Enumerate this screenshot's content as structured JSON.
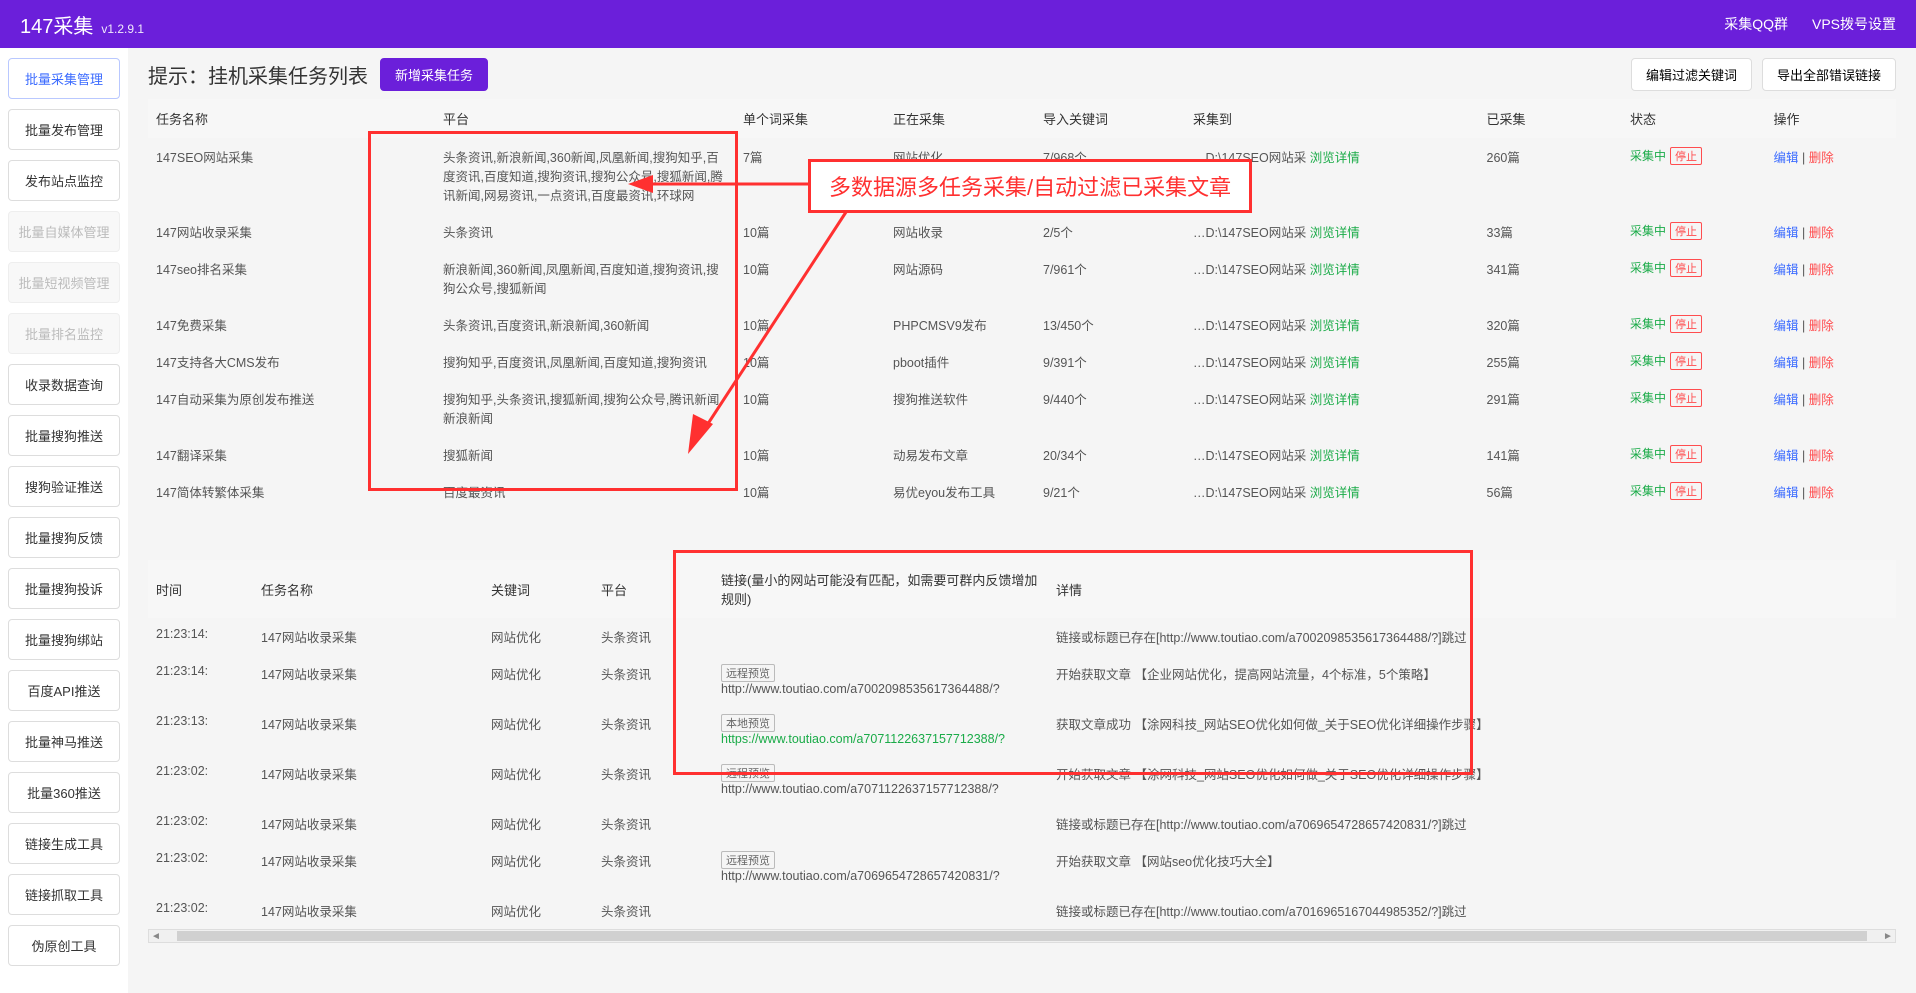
{
  "header": {
    "title": "147采集",
    "version": "v1.2.9.1",
    "links": {
      "qq": "采集QQ群",
      "vps": "VPS拨号设置"
    }
  },
  "sidebar": {
    "items": [
      {
        "label": "批量采集管理",
        "state": "active"
      },
      {
        "label": "批量发布管理",
        "state": ""
      },
      {
        "label": "发布站点监控",
        "state": ""
      },
      {
        "label": "批量自媒体管理",
        "state": "disabled"
      },
      {
        "label": "批量短视频管理",
        "state": "disabled"
      },
      {
        "label": "批量排名监控",
        "state": "disabled"
      },
      {
        "label": "收录数据查询",
        "state": ""
      },
      {
        "label": "批量搜狗推送",
        "state": ""
      },
      {
        "label": "搜狗验证推送",
        "state": ""
      },
      {
        "label": "批量搜狗反馈",
        "state": ""
      },
      {
        "label": "批量搜狗投诉",
        "state": ""
      },
      {
        "label": "批量搜狗绑站",
        "state": ""
      },
      {
        "label": "百度API推送",
        "state": ""
      },
      {
        "label": "批量神马推送",
        "state": ""
      },
      {
        "label": "批量360推送",
        "state": ""
      },
      {
        "label": "链接生成工具",
        "state": ""
      },
      {
        "label": "链接抓取工具",
        "state": ""
      },
      {
        "label": "伪原创工具",
        "state": ""
      }
    ]
  },
  "toolbar": {
    "title": "提示：挂机采集任务列表",
    "new_task": "新增采集任务",
    "edit_filter": "编辑过滤关键词",
    "export_errors": "导出全部错误链接"
  },
  "tasks": {
    "cols": {
      "name": "任务名称",
      "platform": "平台",
      "single": "单个词采集",
      "collecting": "正在采集",
      "imported": "导入关键词",
      "dest": "采集到",
      "collected": "已采集",
      "status": "状态",
      "action": "操作"
    },
    "status_running": "采集中",
    "status_stop": "停止",
    "browse": "浏览详情",
    "edit": "编辑",
    "delete": "删除",
    "rows": [
      {
        "name": "147SEO网站采集",
        "platform": "头条资讯,新浪新闻,360新闻,凤凰新闻,搜狗知乎,百度资讯,百度知道,搜狗资讯,搜狗公众号,搜狐新闻,腾讯新闻,网易资讯,一点资讯,百度最资讯,环球网",
        "single": "7篇",
        "collecting": "网站优化",
        "imported": "7/968个",
        "dest": "…D:\\147SEO网站采",
        "collected": "260篇"
      },
      {
        "name": "147网站收录采集",
        "platform": "头条资讯",
        "single": "10篇",
        "collecting": "网站收录",
        "imported": "2/5个",
        "dest": "…D:\\147SEO网站采",
        "collected": "33篇"
      },
      {
        "name": "147seo排名采集",
        "platform": "新浪新闻,360新闻,凤凰新闻,百度知道,搜狗资讯,搜狗公众号,搜狐新闻",
        "single": "10篇",
        "collecting": "网站源码",
        "imported": "7/961个",
        "dest": "…D:\\147SEO网站采",
        "collected": "341篇"
      },
      {
        "name": "147免费采集",
        "platform": "头条资讯,百度资讯,新浪新闻,360新闻",
        "single": "10篇",
        "collecting": "PHPCMSV9发布",
        "imported": "13/450个",
        "dest": "…D:\\147SEO网站采",
        "collected": "320篇"
      },
      {
        "name": "147支持各大CMS发布",
        "platform": "搜狗知乎,百度资讯,凤凰新闻,百度知道,搜狗资讯",
        "single": "10篇",
        "collecting": "pboot插件",
        "imported": "9/391个",
        "dest": "…D:\\147SEO网站采",
        "collected": "255篇"
      },
      {
        "name": "147自动采集为原创发布推送",
        "platform": "搜狗知乎,头条资讯,搜狐新闻,搜狗公众号,腾讯新闻,新浪新闻",
        "single": "10篇",
        "collecting": "搜狗推送软件",
        "imported": "9/440个",
        "dest": "…D:\\147SEO网站采",
        "collected": "291篇"
      },
      {
        "name": "147翻译采集",
        "platform": "搜狐新闻",
        "single": "10篇",
        "collecting": "动易发布文章",
        "imported": "20/34个",
        "dest": "…D:\\147SEO网站采",
        "collected": "141篇"
      },
      {
        "name": "147简体转繁体采集",
        "platform": "百度最资讯",
        "single": "10篇",
        "collecting": "易优eyou发布工具",
        "imported": "9/21个",
        "dest": "…D:\\147SEO网站采",
        "collected": "56篇"
      }
    ]
  },
  "logs": {
    "cols": {
      "time": "时间",
      "task": "任务名称",
      "keyword": "关键词",
      "platform": "平台",
      "link": "链接(量小的网站可能没有匹配，如需要可群内反馈增加规则)",
      "detail": "详情"
    },
    "tag_remote": "远程预览",
    "tag_local": "本地预览",
    "rows": [
      {
        "time": "21:23:14:",
        "task": "147网站收录采集",
        "keyword": "网站优化",
        "platform": "头条资讯",
        "tag": "",
        "url": "",
        "detail": "链接或标题已存在[http://www.toutiao.com/a7002098535617364488/?]跳过"
      },
      {
        "time": "21:23:14:",
        "task": "147网站收录采集",
        "keyword": "网站优化",
        "platform": "头条资讯",
        "tag": "远程预览",
        "url": "http://www.toutiao.com/a7002098535617364488/?",
        "detail": "开始获取文章 【企业网站优化，提高网站流量，4个标准，5个策略】"
      },
      {
        "time": "21:23:13:",
        "task": "147网站收录采集",
        "keyword": "网站优化",
        "platform": "头条资讯",
        "tag": "本地预览",
        "url": "https://www.toutiao.com/a7071122637157712388/?",
        "green": true,
        "detail": "获取文章成功 【涂网科技_网站SEO优化如何做_关于SEO优化详细操作步骤】"
      },
      {
        "time": "21:23:02:",
        "task": "147网站收录采集",
        "keyword": "网站优化",
        "platform": "头条资讯",
        "tag": "远程预览",
        "url": "http://www.toutiao.com/a7071122637157712388/?",
        "detail": "开始获取文章 【涂网科技_网站SEO优化如何做_关于SEO优化详细操作步骤】"
      },
      {
        "time": "21:23:02:",
        "task": "147网站收录采集",
        "keyword": "网站优化",
        "platform": "头条资讯",
        "tag": "",
        "url": "",
        "detail": "链接或标题已存在[http://www.toutiao.com/a7069654728657420831/?]跳过"
      },
      {
        "time": "21:23:02:",
        "task": "147网站收录采集",
        "keyword": "网站优化",
        "platform": "头条资讯",
        "tag": "远程预览",
        "url": "http://www.toutiao.com/a7069654728657420831/?",
        "detail": "开始获取文章 【网站seo优化技巧大全】"
      },
      {
        "time": "21:23:02:",
        "task": "147网站收录采集",
        "keyword": "网站优化",
        "platform": "头条资讯",
        "tag": "",
        "url": "",
        "detail": "链接或标题已存在[http://www.toutiao.com/a7016965167044985352/?]跳过"
      }
    ]
  },
  "annotation": {
    "text": "多数据源多任务采集/自动过滤已采集文章"
  }
}
